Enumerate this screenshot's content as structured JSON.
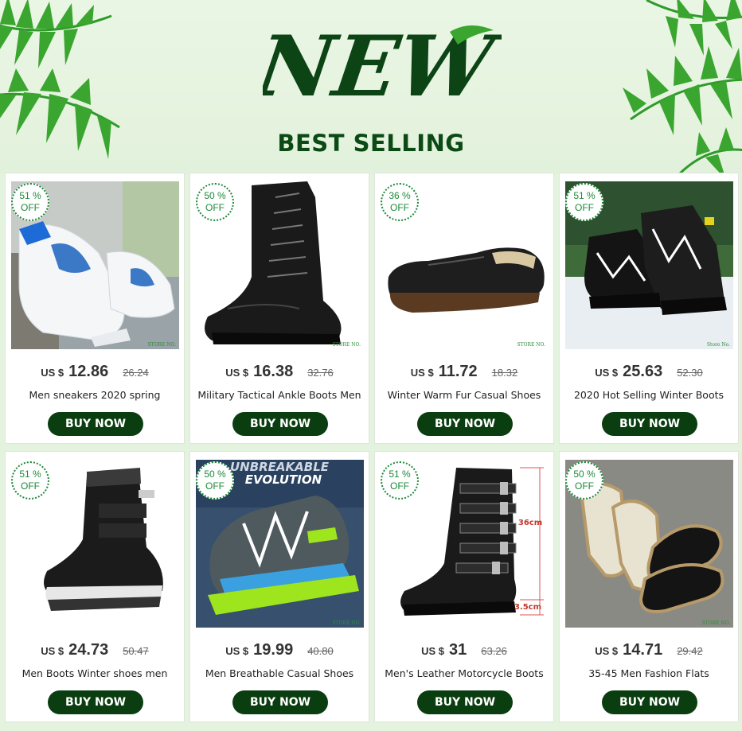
{
  "banner": {
    "logo_text": "NEW",
    "headline": "BEST SELLING"
  },
  "colors": {
    "brand_dark_green": "#0a3d0f",
    "badge_green": "#1c8a3a",
    "background": "#e4f3de"
  },
  "products": [
    {
      "discount": "51 %",
      "off": "OFF",
      "currency": "US $",
      "price": "12.86",
      "old_price": "26.24",
      "title": "Men sneakers 2020 spring",
      "button": "BUY NOW",
      "image": "white-sneakers",
      "store": "STORE NO."
    },
    {
      "discount": "50 %",
      "off": "OFF",
      "currency": "US $",
      "price": "16.38",
      "old_price": "32.76",
      "title": "Military Tactical Ankle Boots Men",
      "button": "BUY NOW",
      "image": "black-ankle-boot",
      "store": "STORE NO."
    },
    {
      "discount": "36 %",
      "off": "OFF",
      "currency": "US $",
      "price": "11.72",
      "old_price": "18.32",
      "title": "Winter Warm Fur Casual Shoes",
      "button": "BUY NOW",
      "image": "black-loafer",
      "store": "STORE NO."
    },
    {
      "discount": "51 %",
      "off": "OFF",
      "currency": "US $",
      "price": "25.63",
      "old_price": "52.30",
      "title": "2020 Hot Selling Winter Boots",
      "button": "BUY NOW",
      "image": "snow-hiking-boots",
      "store": "Store No."
    },
    {
      "discount": "51 %",
      "off": "OFF",
      "currency": "US $",
      "price": "24.73",
      "old_price": "50.47",
      "title": "Men Boots Winter shoes men",
      "button": "BUY NOW",
      "image": "snow-boot",
      "store": ""
    },
    {
      "discount": "50 %",
      "off": "OFF",
      "currency": "US $",
      "price": "19.99",
      "old_price": "40.80",
      "title": "Men Breathable Casual Shoes",
      "button": "BUY NOW",
      "image": "green-trail-shoe",
      "store": "STORE NO.",
      "image_text_1": "UNBREAKABLE",
      "image_text_2": "EVOLUTION"
    },
    {
      "discount": "51 %",
      "off": "OFF",
      "currency": "US $",
      "price": "31",
      "old_price": "63.26",
      "title": "Men's Leather Motorcycle Boots",
      "button": "BUY NOW",
      "image": "motorcycle-boot",
      "store": "",
      "image_text_1": "36cm",
      "image_text_2": "3.5cm"
    },
    {
      "discount": "50 %",
      "off": "OFF",
      "currency": "US $",
      "price": "14.71",
      "old_price": "29.42",
      "title": "35-45 Men Fashion Flats",
      "button": "BUY NOW",
      "image": "espadrilles",
      "store": "STORE NO."
    }
  ]
}
